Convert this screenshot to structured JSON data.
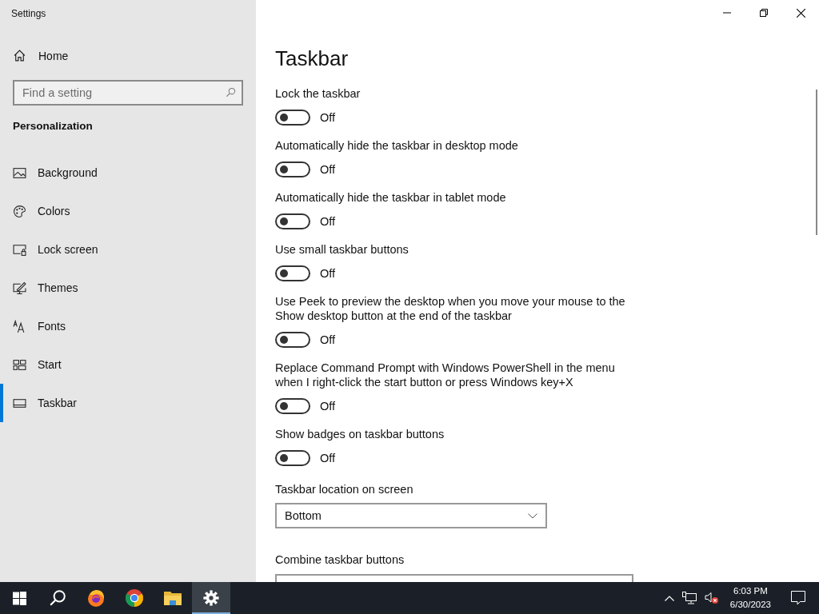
{
  "window": {
    "title": "Settings"
  },
  "sidebar": {
    "home": "Home",
    "search": {
      "placeholder": "Find a setting"
    },
    "section": "Personalization",
    "items": [
      {
        "label": "Background",
        "kind": "background",
        "selected": false
      },
      {
        "label": "Colors",
        "kind": "colors",
        "selected": false
      },
      {
        "label": "Lock screen",
        "kind": "lock",
        "selected": false
      },
      {
        "label": "Themes",
        "kind": "themes",
        "selected": false
      },
      {
        "label": "Fonts",
        "kind": "fonts",
        "selected": false
      },
      {
        "label": "Start",
        "kind": "start",
        "selected": false
      },
      {
        "label": "Taskbar",
        "kind": "taskbar",
        "selected": true
      }
    ]
  },
  "page": {
    "title": "Taskbar",
    "settings": [
      {
        "kind": "toggle",
        "label": "Lock the taskbar",
        "on": false,
        "state": "Off"
      },
      {
        "kind": "toggle",
        "label": "Automatically hide the taskbar in desktop mode",
        "on": false,
        "state": "Off"
      },
      {
        "kind": "toggle",
        "label": "Automatically hide the taskbar in tablet mode",
        "on": false,
        "state": "Off"
      },
      {
        "kind": "toggle",
        "label": "Use small taskbar buttons",
        "on": false,
        "state": "Off"
      },
      {
        "kind": "toggle",
        "label": "Use Peek to preview the desktop when you move your mouse to the Show desktop button at the end of the taskbar",
        "on": false,
        "state": "Off"
      },
      {
        "kind": "toggle",
        "label": "Replace Command Prompt with Windows PowerShell in the menu when I right-click the start button or press Windows key+X",
        "on": false,
        "state": "Off"
      },
      {
        "kind": "toggle",
        "label": "Show badges on taskbar buttons",
        "on": false,
        "state": "Off"
      },
      {
        "kind": "dropdown",
        "label": "Taskbar location on screen",
        "value": "Bottom"
      },
      {
        "kind": "dropdown",
        "label": "Combine taskbar buttons"
      }
    ]
  },
  "taskbar": {
    "apps": [
      {
        "kind": "start",
        "selected": false
      },
      {
        "kind": "search",
        "selected": false
      },
      {
        "kind": "firefox",
        "selected": false
      },
      {
        "kind": "chrome",
        "selected": false
      },
      {
        "kind": "folder",
        "selected": false
      },
      {
        "kind": "settings",
        "selected": true
      }
    ],
    "time": "6:03 PM",
    "date": "6/30/2023"
  }
}
